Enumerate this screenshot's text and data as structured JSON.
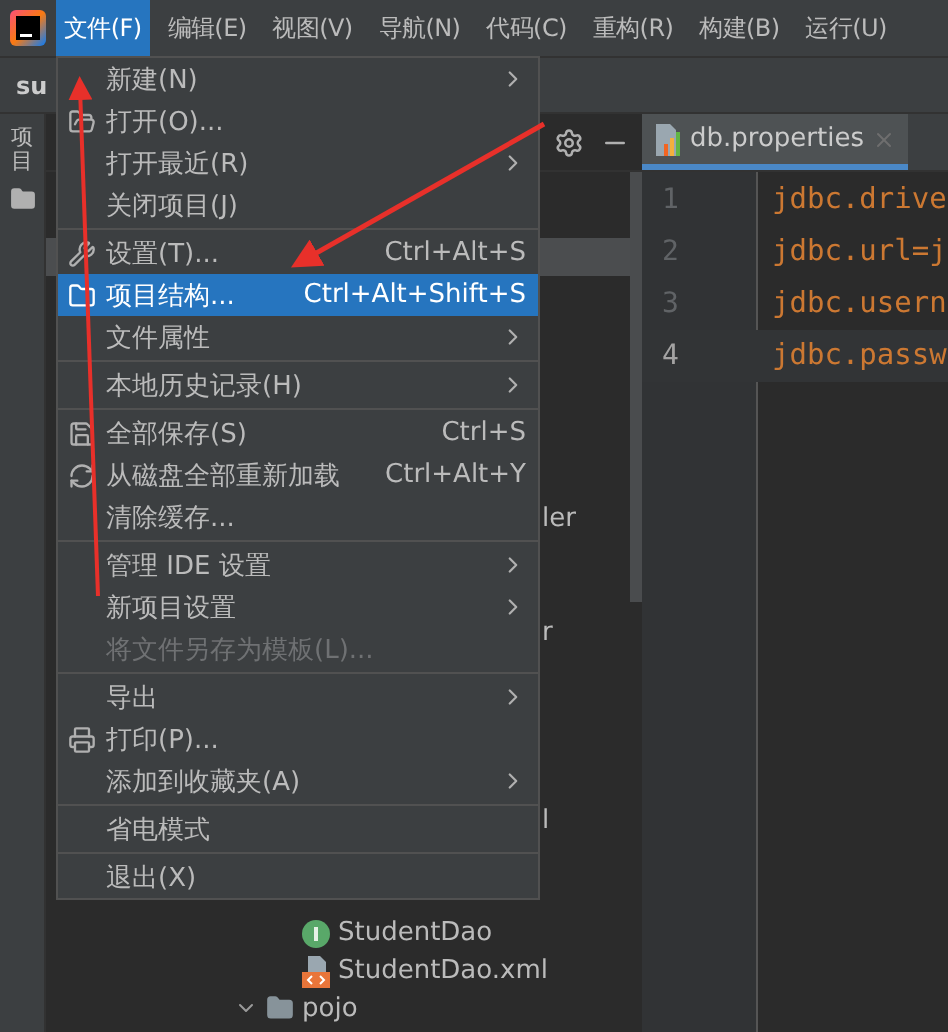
{
  "menu_bar": {
    "items": [
      {
        "label": "文件(F)",
        "selected": true
      },
      {
        "label": "编辑(E)",
        "selected": false
      },
      {
        "label": "视图(V)",
        "selected": false
      },
      {
        "label": "导航(N)",
        "selected": false
      },
      {
        "label": "代码(C)",
        "selected": false
      },
      {
        "label": "重构(R)",
        "selected": false
      },
      {
        "label": "构建(B)",
        "selected": false
      },
      {
        "label": "运行(U)",
        "selected": false
      }
    ]
  },
  "navigation_bar": {
    "path": "su"
  },
  "tool_strip": {
    "label": "项目"
  },
  "file_menu": {
    "groups": [
      [
        {
          "label": "新建(N)",
          "submenu": true,
          "disabled": false,
          "selected": false
        },
        {
          "label": "打开(O)...",
          "submenu": false,
          "disabled": false,
          "selected": false
        },
        {
          "label": "打开最近(R)",
          "submenu": true,
          "disabled": false,
          "selected": false
        },
        {
          "label": "关闭项目(J)",
          "submenu": false,
          "disabled": false,
          "selected": false
        }
      ],
      [
        {
          "label": "设置(T)...",
          "shortcut": "Ctrl+Alt+S",
          "submenu": false,
          "disabled": false,
          "selected": false
        },
        {
          "label": "项目结构...",
          "shortcut": "Ctrl+Alt+Shift+S",
          "submenu": false,
          "disabled": false,
          "selected": true
        },
        {
          "label": "文件属性",
          "submenu": true,
          "disabled": false,
          "selected": false
        }
      ],
      [
        {
          "label": "本地历史记录(H)",
          "submenu": true,
          "disabled": false,
          "selected": false
        }
      ],
      [
        {
          "label": "全部保存(S)",
          "shortcut": "Ctrl+S",
          "submenu": false,
          "disabled": false,
          "selected": false
        },
        {
          "label": "从磁盘全部重新加载",
          "shortcut": "Ctrl+Alt+Y",
          "submenu": false,
          "disabled": false,
          "selected": false
        },
        {
          "label": "清除缓存...",
          "submenu": false,
          "disabled": false,
          "selected": false
        }
      ],
      [
        {
          "label": "管理 IDE 设置",
          "submenu": true,
          "disabled": false,
          "selected": false
        },
        {
          "label": "新项目设置",
          "submenu": true,
          "disabled": false,
          "selected": false
        },
        {
          "label": "将文件另存为模板(L)...",
          "submenu": false,
          "disabled": true,
          "selected": false
        }
      ],
      [
        {
          "label": "导出",
          "submenu": true,
          "disabled": false,
          "selected": false
        },
        {
          "label": "打印(P)...",
          "submenu": false,
          "disabled": false,
          "selected": false
        },
        {
          "label": "添加到收藏夹(A)",
          "submenu": true,
          "disabled": false,
          "selected": false
        }
      ],
      [
        {
          "label": "省电模式",
          "submenu": false,
          "disabled": false,
          "selected": false
        }
      ],
      [
        {
          "label": "退出(X)",
          "submenu": false,
          "disabled": false,
          "selected": false
        }
      ]
    ]
  },
  "project_tree": {
    "rows": [
      {
        "kind": "blank",
        "selected": true
      },
      {
        "kind": "tail",
        "label": "ler",
        "selected": false
      },
      {
        "kind": "tail",
        "label": "r",
        "selected": false
      },
      {
        "kind": "tail",
        "label": "l",
        "selected": false
      },
      {
        "kind": "interface",
        "label": "StudentDao",
        "selected": false
      },
      {
        "kind": "xml",
        "label": "StudentDao.xml",
        "selected": false
      },
      {
        "kind": "folder",
        "label": "pojo",
        "selected": false
      }
    ]
  },
  "editor": {
    "tab": {
      "label": "db.properties",
      "selected": true
    },
    "lines": [
      {
        "number": "1",
        "code": "jdbc.drive",
        "current": false
      },
      {
        "number": "2",
        "code": "jdbc.url=j",
        "current": false
      },
      {
        "number": "3",
        "code": "jdbc.usern",
        "current": false
      },
      {
        "number": "4",
        "code": "jdbc.passw",
        "current": true
      }
    ]
  }
}
